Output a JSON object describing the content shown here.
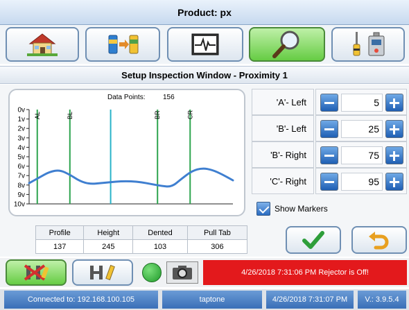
{
  "window": {
    "title": "Product: px"
  },
  "nav": {
    "buttons": [
      {
        "name": "home"
      },
      {
        "name": "transfer"
      },
      {
        "name": "monitor"
      },
      {
        "name": "inspect",
        "active": true
      },
      {
        "name": "tools"
      }
    ]
  },
  "panel": {
    "title": "Setup Inspection Window - Proximity 1"
  },
  "chart_data": {
    "type": "line",
    "data_points_label": "Data Points:",
    "data_points_value": "156",
    "y_ticks": [
      "0v",
      "1v",
      "2v",
      "3v",
      "4v",
      "5v",
      "6v",
      "7v",
      "8v",
      "9v",
      "10v"
    ],
    "ylim": [
      0,
      10
    ],
    "y_inverted": true,
    "xlim": [
      0,
      100
    ],
    "series": [
      {
        "x": [
          0,
          5,
          10,
          15,
          20,
          25,
          30,
          35,
          40,
          45,
          50,
          55,
          60,
          65,
          70,
          75,
          80,
          85,
          90,
          95,
          100
        ],
        "values": [
          7.8,
          7.2,
          6.6,
          6.4,
          6.9,
          7.6,
          7.9,
          7.8,
          7.7,
          7.6,
          7.6,
          7.7,
          7.9,
          8.1,
          8.2,
          7.3,
          6.5,
          6.2,
          6.4,
          6.9,
          7.5
        ],
        "color": "#3f7fd0"
      }
    ],
    "markers": [
      {
        "label": "AL",
        "x": 4,
        "color": "#2da44e"
      },
      {
        "label": "BL",
        "x": 20,
        "color": "#2da44e"
      },
      {
        "label": "",
        "x": 40,
        "color": "#29b3c9"
      },
      {
        "label": "BR",
        "x": 63,
        "color": "#2da44e"
      },
      {
        "label": "CR",
        "x": 79,
        "color": "#2da44e"
      }
    ]
  },
  "params": [
    {
      "label": "'A'- Left",
      "value": "5"
    },
    {
      "label": "'B'- Left",
      "value": "25"
    },
    {
      "label": "'B'- Right",
      "value": "75"
    },
    {
      "label": "'C'- Right",
      "value": "95"
    }
  ],
  "show_markers": {
    "label": "Show Markers",
    "checked": true
  },
  "stats": {
    "headers": [
      "Profile",
      "Height",
      "Dented",
      "Pull Tab"
    ],
    "values": [
      "137",
      "245",
      "103",
      "306"
    ]
  },
  "alert": {
    "text": "4/26/2018 7:31:06 PM Rejector is Off!",
    "color": "#e3191c"
  },
  "statusbar": {
    "connection": "Connected to: 192.168.100.105",
    "app": "taptone",
    "datetime": "4/26/2018 7:31:07 PM",
    "version": "V.: 3.9.5.4"
  },
  "colors": {
    "accent": "#3f7fd0",
    "active_green": "#66cc44",
    "alert_red": "#e3191c"
  }
}
